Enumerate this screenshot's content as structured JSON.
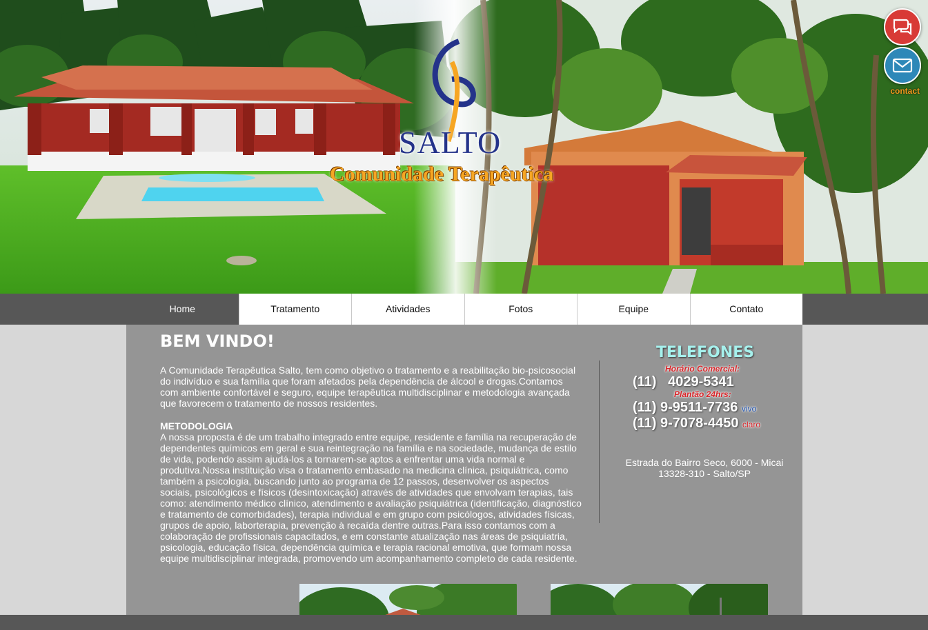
{
  "hero": {
    "logo_word": "SALTO",
    "logo_sub": "Comunidade Terapêutica",
    "contact_label": "contact"
  },
  "nav": {
    "items": [
      "Home",
      "Tratamento",
      "Atividades",
      "Fotos",
      "Equipe",
      "Contato"
    ],
    "active": "Home"
  },
  "main": {
    "title": "BEM VINDO!",
    "intro": "A Comunidade Terapêutica Salto, tem como objetivo o tratamento e a reabilitação bio-psicosocial do indivíduo e sua família que foram afetados pela dependência de álcool e drogas.Contamos com ambiente confortável e seguro, equipe terapêutica multidisciplinar e metodologia avançada que favorecem o tratamento de nossos residentes.",
    "method_title": "METODOLOGIA",
    "method_text": "A nossa proposta é de um trabalho integrado entre equipe, residente e família na recuperação de dependentes químicos em geral e sua reintegração na família e na sociedade, mudança de estilo de vida, podendo assim ajudá-los a tornarem-se aptos a enfrentar uma vida normal e produtiva.Nossa instituição visa o tratamento embasado na medicina clínica, psiquiátrica, como também a psicologia, buscando junto ao programa de 12 passos, desenvolver os aspectos sociais, psicológicos e físicos (desintoxicação) através de atividades que envolvam terapias, tais como: atendimento médico clínico, atendimento e avaliação psiquiátrica (identificação, diagnóstico e tratamento de comorbidades), terapia individual e em grupo com psicólogos, atividades físicas, grupos de apoio, laborterapia, prevenção à recaída dentre outras.Para isso contamos com a colaboração de profissionais capacitados, e em constante atualização nas áreas de psiquiatria, psicologia, educação física, dependência química e terapia racional emotiva, que formam nossa equipe multidisciplinar integrada, promovendo um acompanhamento completo de cada residente."
  },
  "phones": {
    "title": "TELEFONES",
    "commercial_label": "Horário Comercial:",
    "commercial_ddd": "(11)",
    "commercial_number": "4029-5341",
    "duty_label": "Plantão 24hrs:",
    "mobile1": "(11) 9-9511-7736",
    "mobile1_carrier": "vivo",
    "mobile2": "(11) 9-7078-4450",
    "mobile2_carrier": "claro"
  },
  "address": {
    "line1": "Estrada do Bairro Seco, 6000 - Micai",
    "line2": "13328-310 - Salto/SP"
  },
  "colors": {
    "nav_bar": "#575757",
    "content_bg": "#959595",
    "page_bg": "#d7d7d7",
    "phones_title": "#a6f0ec",
    "accent_red": "#d9262b",
    "chat_button": "#d83a36",
    "mail_button": "#2e88b8"
  },
  "icons": [
    "chat-icon",
    "mail-icon"
  ]
}
